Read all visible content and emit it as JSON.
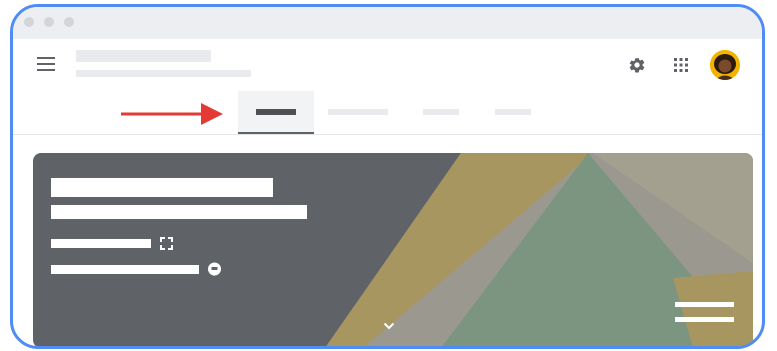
{
  "window": {
    "controls": [
      "close",
      "minimize",
      "maximize"
    ]
  },
  "header": {
    "title_text": "",
    "subtitle_text": "",
    "icons": [
      "menu-icon",
      "gear-icon",
      "apps-grid-icon",
      "avatar"
    ]
  },
  "tabs": {
    "active_index": 0,
    "items": [
      {
        "label": "",
        "active": true
      },
      {
        "label": "",
        "active": false
      },
      {
        "label": "",
        "active": false
      },
      {
        "label": "",
        "active": false
      }
    ]
  },
  "annotation": {
    "arrow_color": "#e53935",
    "points_to": "tab-1"
  },
  "banner": {
    "title_text": "",
    "subtitle_text": "",
    "info_lines": [
      "",
      ""
    ],
    "icons": [
      "fullscreen-icon",
      "chat-icon",
      "chevron-down-icon",
      "hamburger-lines-icon"
    ]
  },
  "colors": {
    "frame_border": "#4f8cf3",
    "titlebar": "#eceef1",
    "banner_bg": "#5f6368",
    "shape_gold": "#a89660",
    "shape_taupe": "#a4a08f",
    "shape_green": "#7b9581",
    "shape_gray": "#9b998f",
    "avatar_bg": "#f2b400"
  }
}
